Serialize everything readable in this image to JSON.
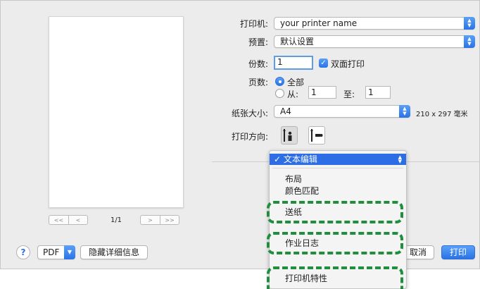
{
  "printer": {
    "label": "打印机:",
    "value": "your printer name"
  },
  "presets": {
    "label": "预置:",
    "value": "默认设置"
  },
  "copies": {
    "label": "份数:",
    "value": "1",
    "two_sided_label": "双面打印"
  },
  "pages": {
    "label": "页数:",
    "all_label": "全部",
    "from_label": "从:",
    "from_value": "1",
    "to_label": "至:",
    "to_value": "1"
  },
  "paper_size": {
    "label": "纸张大小:",
    "value": "A4",
    "dimensions": "210 x 297 毫米"
  },
  "orientation": {
    "label": "打印方向:"
  },
  "preview": {
    "page_count": "1/1",
    "nav_first": "<<",
    "nav_prev": "<",
    "nav_next": ">",
    "nav_last": ">>"
  },
  "menu": {
    "selected": "✓ 文本编辑",
    "items": [
      "布局",
      "颜色匹配",
      "送纸",
      "作业日志",
      "打印机特性"
    ]
  },
  "footer": {
    "help": "?",
    "pdf_label": "PDF",
    "hide_details": "隐藏详细信息",
    "cancel": "取消",
    "print": "打印"
  },
  "colors": {
    "accent": "#2d6ee6",
    "highlight": "#1f8f3e"
  }
}
